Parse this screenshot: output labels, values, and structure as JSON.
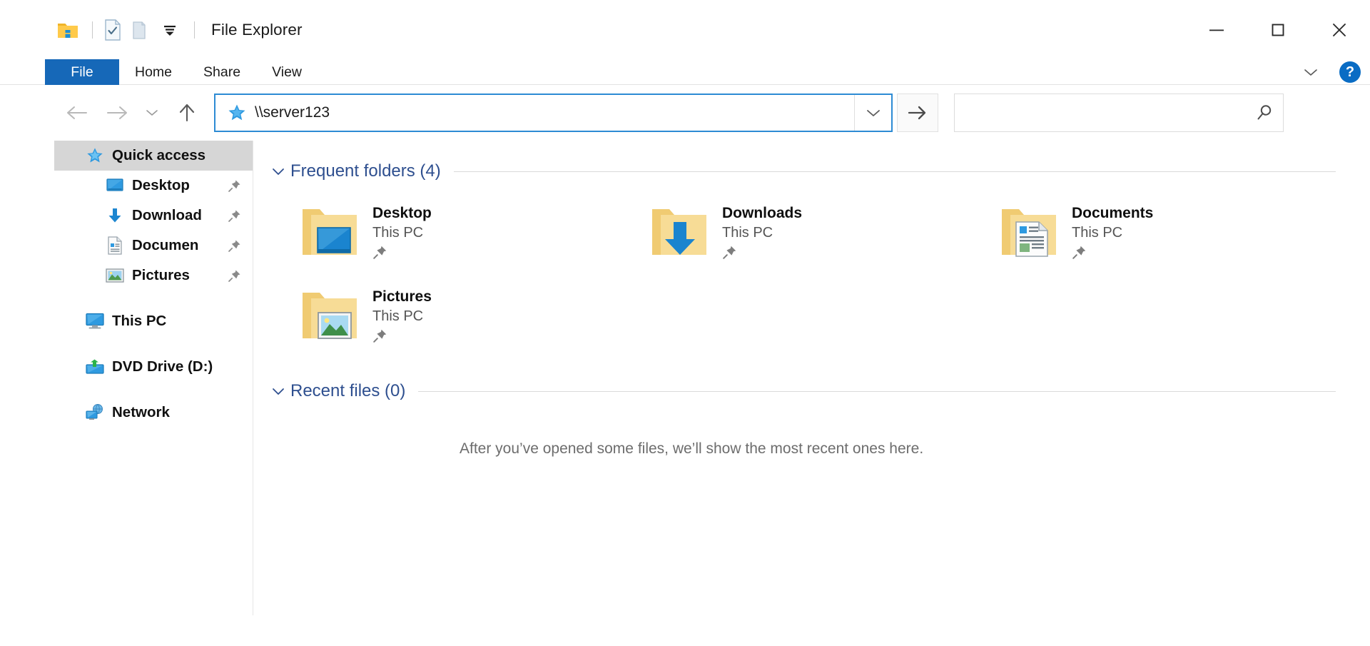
{
  "window": {
    "title": "File Explorer",
    "quick_access_toolbar": [
      {
        "name": "explorer-app-icon",
        "label": "File Explorer"
      },
      {
        "name": "properties-icon",
        "label": "Properties"
      },
      {
        "name": "new-folder-icon",
        "label": "New folder"
      },
      {
        "name": "customize-qat-icon",
        "label": "Customize Quick Access Toolbar"
      }
    ],
    "controls": {
      "minimize": "Minimize",
      "maximize": "Maximize",
      "close": "Close"
    }
  },
  "ribbon": {
    "tabs": [
      {
        "label": "File",
        "active": true
      },
      {
        "label": "Home",
        "active": false
      },
      {
        "label": "Share",
        "active": false
      },
      {
        "label": "View",
        "active": false
      }
    ],
    "collapse_label": "Minimize the Ribbon",
    "help_label": "?"
  },
  "navigation": {
    "back": "Back",
    "forward": "Forward",
    "recent_locations": "Recent locations",
    "up": "Up",
    "address": {
      "value": "\\\\server123",
      "icon": "quick-access-star-icon",
      "dropdown": "Previous locations",
      "go": "Go to \\\\server123"
    },
    "search": {
      "value": "",
      "placeholder": ""
    }
  },
  "sidebar": {
    "items": [
      {
        "label": "Quick access",
        "icon": "star-icon",
        "selected": true,
        "pinned": false,
        "level": "root"
      },
      {
        "label": "Desktop",
        "icon": "desktop-icon",
        "selected": false,
        "pinned": true,
        "level": "child"
      },
      {
        "label": "Download",
        "icon": "download-icon",
        "selected": false,
        "pinned": true,
        "level": "child"
      },
      {
        "label": "Documen",
        "icon": "documents-icon",
        "selected": false,
        "pinned": true,
        "level": "child"
      },
      {
        "label": "Pictures",
        "icon": "pictures-icon",
        "selected": false,
        "pinned": true,
        "level": "child"
      },
      {
        "label": "This PC",
        "icon": "this-pc-icon",
        "selected": false,
        "pinned": false,
        "level": "root",
        "gap_before": true
      },
      {
        "label": "DVD Drive (D:)",
        "icon": "dvd-drive-icon",
        "selected": false,
        "pinned": false,
        "level": "root",
        "gap_before": true
      },
      {
        "label": "Network",
        "icon": "network-icon",
        "selected": false,
        "pinned": false,
        "level": "root",
        "gap_before": true
      }
    ]
  },
  "content": {
    "frequent_folders": {
      "title": "Frequent folders (4)",
      "expanded": true,
      "items": [
        {
          "name": "Desktop",
          "location": "This PC",
          "icon": "folder-desktop-icon",
          "pinned": true
        },
        {
          "name": "Downloads",
          "location": "This PC",
          "icon": "folder-downloads-icon",
          "pinned": true
        },
        {
          "name": "Documents",
          "location": "This PC",
          "icon": "folder-documents-icon",
          "pinned": true
        },
        {
          "name": "Pictures",
          "location": "This PC",
          "icon": "folder-pictures-icon",
          "pinned": true
        }
      ]
    },
    "recent_files": {
      "title": "Recent files (0)",
      "expanded": true,
      "empty_message": "After you’ve opened some files, we’ll show the most recent ones here."
    }
  },
  "colors": {
    "accent": "#1668b8",
    "link": "#2e4f8f",
    "selection": "#d6d6d6",
    "focus_border": "#2d8bd4",
    "folder": "#f5d27c"
  }
}
